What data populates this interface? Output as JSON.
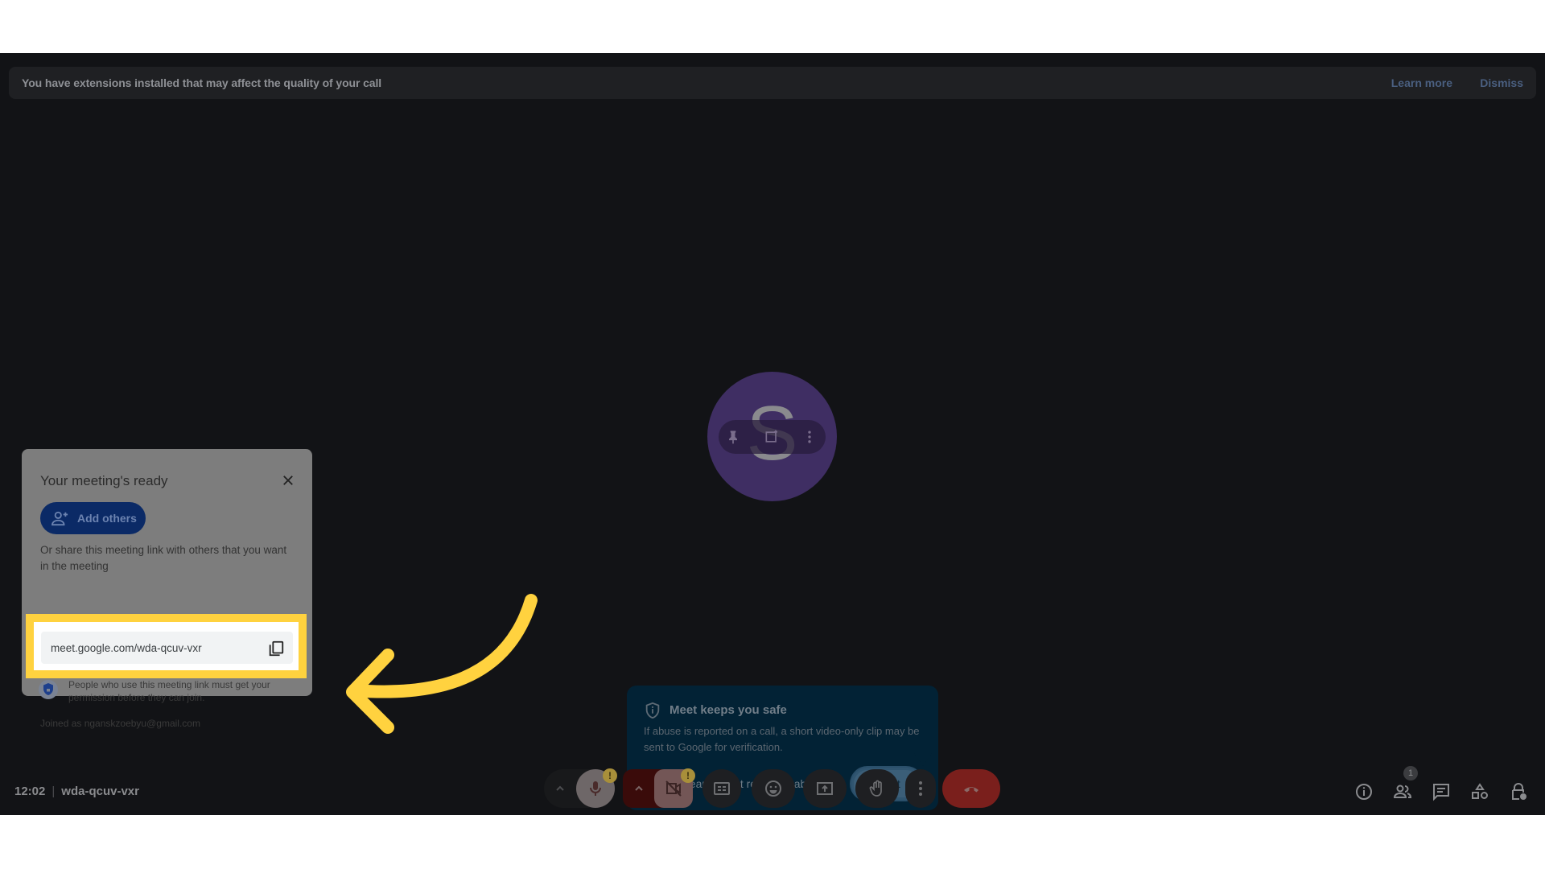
{
  "banner": {
    "message": "You have extensions installed that may affect the quality of your call",
    "learn_more": "Learn more",
    "dismiss": "Dismiss"
  },
  "participant": {
    "initial": "S",
    "avatar_color": "#3f2e63",
    "tile_actions": [
      "pin-icon",
      "frame-icon",
      "more-vert-icon"
    ]
  },
  "meeting_card": {
    "title": "Your meeting's ready",
    "add_others_label": "Add others",
    "share_text": "Or share this meeting link with others that you want in the meeting",
    "link": "meet.google.com/wda-qcuv-vxr",
    "permission_note": "People who use this meeting link must get your permission before they can join.",
    "joined_as": "Joined as nganskzoebyu@gmail.com"
  },
  "annotation": {
    "highlight_color": "#ffd23f",
    "arrow_color": "#ffd23f"
  },
  "safety_popup": {
    "title": "Meet keeps you safe",
    "body": "If abuse is reported on a call, a short video-only clip may be sent to Google for verification.",
    "learn_link": "Learn about reporting abuse",
    "got_it": "Got it"
  },
  "bottom_bar": {
    "time": "12:02",
    "meeting_code": "wda-qcuv-vxr",
    "controls": [
      {
        "name": "audio-options",
        "icon": "chevron-up-icon"
      },
      {
        "name": "microphone",
        "icon": "mic-icon",
        "warning": "!"
      },
      {
        "name": "video-options",
        "icon": "chevron-up-icon"
      },
      {
        "name": "camera-off",
        "icon": "videocam-off-icon",
        "warning": "!"
      },
      {
        "name": "captions",
        "icon": "closed-captions-icon"
      },
      {
        "name": "reactions",
        "icon": "emoji-icon"
      },
      {
        "name": "present-screen",
        "icon": "present-icon"
      },
      {
        "name": "raise-hand",
        "icon": "hand-icon"
      },
      {
        "name": "more-options",
        "icon": "more-vert-icon"
      },
      {
        "name": "leave-call",
        "icon": "call-end-icon"
      }
    ],
    "right_icons": [
      "info-icon",
      "people-icon",
      "chat-icon",
      "activities-icon",
      "host-controls-icon"
    ],
    "people_count": "1",
    "end_call_color": "#7a1f1c"
  }
}
